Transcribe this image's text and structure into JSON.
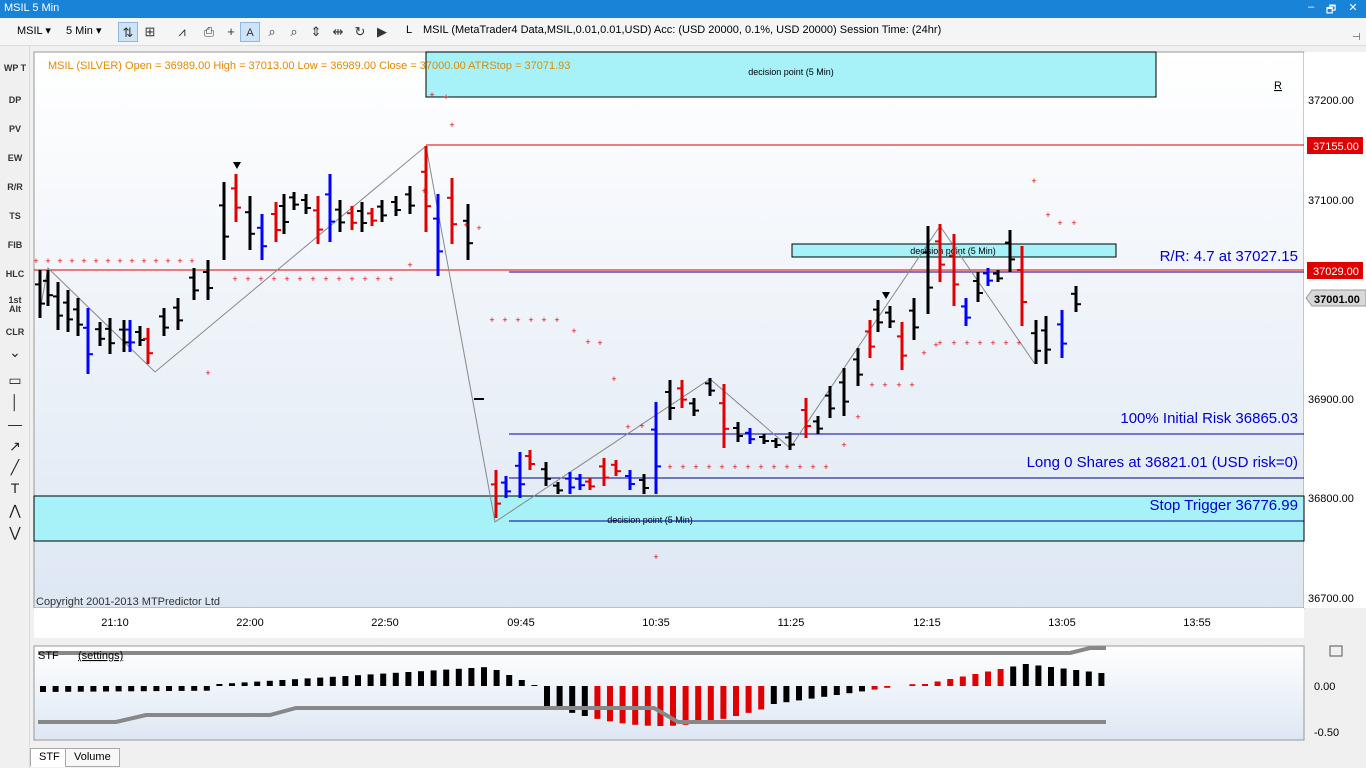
{
  "window": {
    "title": "MSIL 5 Min",
    "minimize": "–",
    "restore": "🗗",
    "close": "✕"
  },
  "toolbar": {
    "symbol": "MSIL",
    "timeframe": "5 Min",
    "l_label": "L",
    "info": "MSIL (MetaTrader4 Data,MSIL,0.01,0.01,USD) Acc: (USD 20000, 0.1%, USD 20000) Session Time: (24hr)"
  },
  "left_tools": [
    "WP T",
    "DP",
    "PV",
    "EW",
    "R/R",
    "TS",
    "FIB",
    "HLC",
    "1st Alt",
    "CLR"
  ],
  "chart": {
    "header": "MSIL (SILVER) Open = 36989.00 High = 37013.00 Low = 36989.00 Close = 37000.00 ATRStop = 37071.93",
    "copyright": "Copyright 2001-2013 MTPredictor Ltd",
    "r_marker": "R",
    "y_ticks": [
      "37200.00",
      "37100.00",
      "36900.00",
      "36800.00",
      "36700.00"
    ],
    "x_ticks": [
      "21:10",
      "22:00",
      "22:50",
      "09:45",
      "10:35",
      "11:25",
      "12:15",
      "13:05",
      "13:55"
    ],
    "price_labels": {
      "upper": "37155.00",
      "mid": "37029.00",
      "current": "37001.00"
    },
    "zones": {
      "top": "decision point (5 Min)",
      "mid": "decision point (5 Min)",
      "bottom": "decision point (5 Min)"
    },
    "annotations": {
      "rr": "R/R: 4.7 at 37027.15",
      "initial_risk": "100% Initial Risk 36865.03",
      "long": "Long 0 Shares at 36821.01 (USD risk=0)",
      "stop": "Stop Trigger 36776.99"
    },
    "colors": {
      "up": "#000000",
      "down": "#e00000",
      "blue": "#0000ff",
      "zone": "#a6f2f8",
      "stop_dots": "#e00000"
    }
  },
  "stf": {
    "title": "STF",
    "settings": "(settings)",
    "y_ticks": [
      "0.00",
      "-0.50"
    ]
  },
  "tabs": [
    "STF",
    "Volume"
  ]
}
